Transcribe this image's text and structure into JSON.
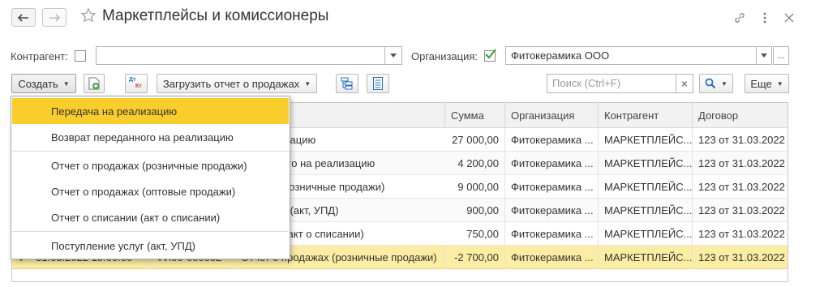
{
  "window": {
    "title": "Маркетплейсы и комиссионеры"
  },
  "filters": {
    "counterparty_label": "Контрагент:",
    "counterparty_value": "",
    "organization_label": "Организация:",
    "organization_value": "Фитокерамика ООО",
    "organization_checked": true,
    "more_btn": "..."
  },
  "toolbar": {
    "create_label": "Создать",
    "load_report_label": "Загрузить отчет о продажах",
    "search_placeholder": "Поиск (Ctrl+F)",
    "clear_icon": "×",
    "more_label": "Еще",
    "dtkt_top": "Дт",
    "dtkt_bottom": "Кт"
  },
  "table": {
    "columns": [
      "Сумма",
      "Организация",
      "Контрагент",
      "Договор"
    ],
    "rows": [
      {
        "doc": "на реализацию",
        "sum": "27 000,00",
        "org": "Фитокерамика ...",
        "contractor": "МАРКЕТПЛЕЙС...",
        "contract": "123 от 31.03.2022"
      },
      {
        "doc": "ереданного на реализацию",
        "sum": "4 200,00",
        "org": "Фитокерамика ...",
        "contractor": "МАРКЕТПЛЕЙС...",
        "contract": "123 от 31.03.2022"
      },
      {
        "doc": "одажах (розничные продажи)",
        "sum": "9 000,00",
        "org": "Фитокерамика ...",
        "contractor": "МАРКЕТПЛЕЙС...",
        "contract": "123 от 31.03.2022"
      },
      {
        "doc": "ние услуг (акт, УПД)",
        "sum": "900,00",
        "org": "Фитокерамика ...",
        "contractor": "МАРКЕТПЛЕЙС...",
        "contract": "123 от 31.03.2022"
      },
      {
        "doc": "писании (акт о списании)",
        "sum": "750,00",
        "org": "Фитокерамика ...",
        "contractor": "МАРКЕТПЛЕЙС...",
        "contract": "123 от 31.03.2022"
      },
      {
        "doc": "Отчет о продажах (розничные продажи)",
        "sum": "-2 700,00",
        "org": "Фитокерамика ...",
        "contractor": "МАРКЕТПЛЕЙС...",
        "contract": "123 от 31.03.2022"
      }
    ],
    "last_row_partial": {
      "date": "31.03.2022 15:00:00",
      "number": "ФИ00-000002"
    }
  },
  "create_menu": {
    "items": [
      "Передача на реализацию",
      "Возврат переданного на реализацию",
      "Отчет о продажах (розничные продажи)",
      "Отчет о продажах (оптовые продажи)",
      "Отчет о списании (акт о списании)",
      "Поступление услуг (акт, УПД)"
    ],
    "active_index": 0
  },
  "colors": {
    "highlight": "#f9cd2b",
    "selected_row": "#fbeda3",
    "check_green": "#3aa33a"
  }
}
